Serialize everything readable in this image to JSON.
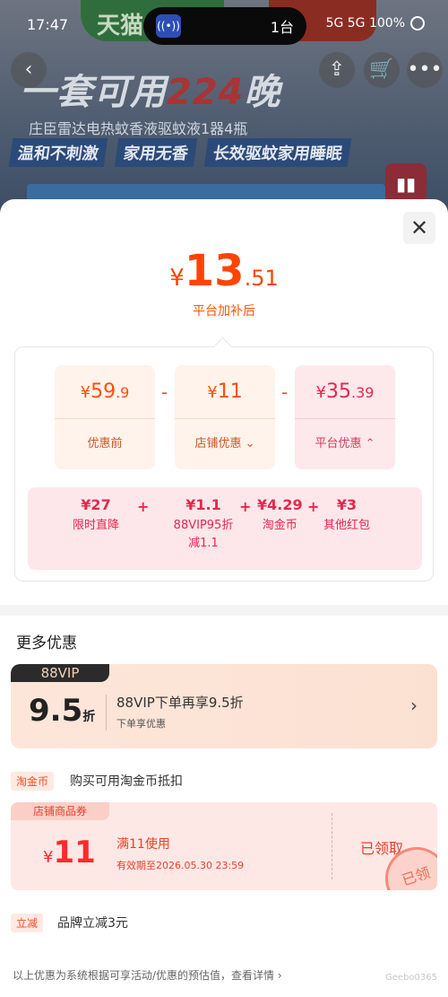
{
  "status_bar": {
    "time": "17:47",
    "island_app": "((•))",
    "island_count": "1台",
    "right_text": "5G  5G  100%"
  },
  "banner": {
    "tmall": "天猫",
    "headline_pre": "一套可用",
    "headline_num": "224",
    "headline_post": "晚",
    "subtitle": "庄臣雷达电热蚊香液驱蚊液1器4瓶",
    "tags": [
      "温和不刺激",
      "家用无香",
      "长效驱蚊家用睡眠"
    ]
  },
  "nav": {
    "back": "‹",
    "share": "⇪",
    "cart": "🛒",
    "more": "•••",
    "chart": "▮▮"
  },
  "sheet": {
    "close": "✕",
    "final_price": {
      "currency": "¥",
      "integer": "13",
      "decimal": ".51"
    },
    "final_label": "平台加补后",
    "boxes": [
      {
        "currency": "¥",
        "integer": "59",
        "decimal": ".9",
        "label": "优惠前"
      },
      {
        "currency": "¥",
        "integer": "11",
        "decimal": "",
        "label": "店铺优惠 ⌄"
      },
      {
        "currency": "¥",
        "integer": "35",
        "decimal": ".39",
        "label": "平台优惠 ⌃"
      }
    ],
    "minus": "-",
    "plus": "+",
    "platform_items": [
      {
        "value": "¥27",
        "label": "限时直降"
      },
      {
        "value": "¥1.1",
        "label": "88VIP95折\n减1.1"
      },
      {
        "value": "¥4.29",
        "label": "淘金币"
      },
      {
        "value": "¥3",
        "label": "其他红包"
      }
    ]
  },
  "more": {
    "title": "更多优惠",
    "vip": {
      "badge": "88VIP",
      "number": "9.5",
      "unit": "折",
      "main": "88VIP下单再享9.5折",
      "sub": "下单享优惠",
      "arrow": "›"
    },
    "taojinbi": {
      "tag": "淘金币",
      "text": "购买可用淘金币抵扣"
    },
    "coupon": {
      "tag": "店铺商品券",
      "currency": "¥",
      "amount": "11",
      "condition": "满11使用",
      "expiry": "有效期至2026.05.30 23:59",
      "status": "已领取",
      "stamp": "已领"
    },
    "lijian": {
      "tag": "立减",
      "text": "品牌立减3元"
    }
  },
  "footer": {
    "note": "以上优惠为系统根据可享活动/优惠的预估值，查看详情 ›",
    "watermark": "Geebo0365"
  }
}
